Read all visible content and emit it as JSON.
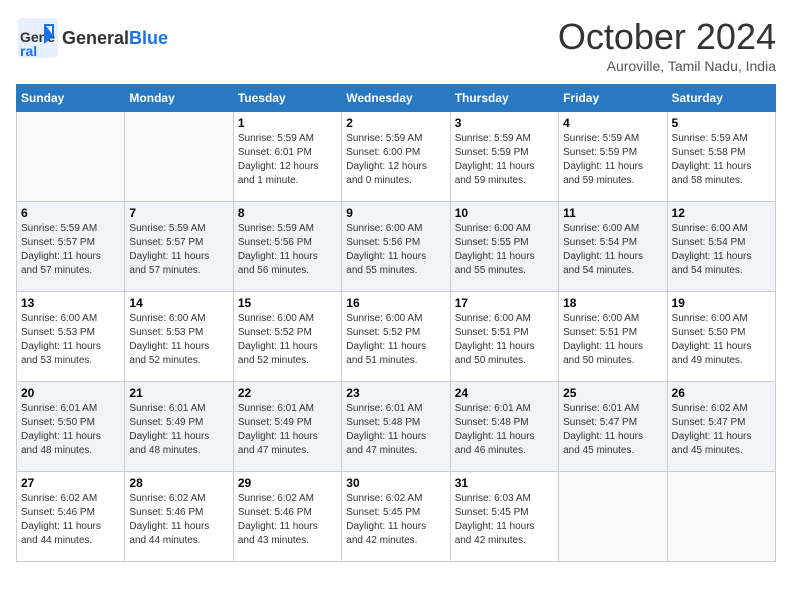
{
  "header": {
    "logo_general": "General",
    "logo_blue": "Blue",
    "month": "October 2024",
    "location": "Auroville, Tamil Nadu, India"
  },
  "weekdays": [
    "Sunday",
    "Monday",
    "Tuesday",
    "Wednesday",
    "Thursday",
    "Friday",
    "Saturday"
  ],
  "weeks": [
    [
      {
        "day": "",
        "info": ""
      },
      {
        "day": "",
        "info": ""
      },
      {
        "day": "1",
        "info": "Sunrise: 5:59 AM\nSunset: 6:01 PM\nDaylight: 12 hours\nand 1 minute."
      },
      {
        "day": "2",
        "info": "Sunrise: 5:59 AM\nSunset: 6:00 PM\nDaylight: 12 hours\nand 0 minutes."
      },
      {
        "day": "3",
        "info": "Sunrise: 5:59 AM\nSunset: 5:59 PM\nDaylight: 11 hours\nand 59 minutes."
      },
      {
        "day": "4",
        "info": "Sunrise: 5:59 AM\nSunset: 5:59 PM\nDaylight: 11 hours\nand 59 minutes."
      },
      {
        "day": "5",
        "info": "Sunrise: 5:59 AM\nSunset: 5:58 PM\nDaylight: 11 hours\nand 58 minutes."
      }
    ],
    [
      {
        "day": "6",
        "info": "Sunrise: 5:59 AM\nSunset: 5:57 PM\nDaylight: 11 hours\nand 57 minutes."
      },
      {
        "day": "7",
        "info": "Sunrise: 5:59 AM\nSunset: 5:57 PM\nDaylight: 11 hours\nand 57 minutes."
      },
      {
        "day": "8",
        "info": "Sunrise: 5:59 AM\nSunset: 5:56 PM\nDaylight: 11 hours\nand 56 minutes."
      },
      {
        "day": "9",
        "info": "Sunrise: 6:00 AM\nSunset: 5:56 PM\nDaylight: 11 hours\nand 55 minutes."
      },
      {
        "day": "10",
        "info": "Sunrise: 6:00 AM\nSunset: 5:55 PM\nDaylight: 11 hours\nand 55 minutes."
      },
      {
        "day": "11",
        "info": "Sunrise: 6:00 AM\nSunset: 5:54 PM\nDaylight: 11 hours\nand 54 minutes."
      },
      {
        "day": "12",
        "info": "Sunrise: 6:00 AM\nSunset: 5:54 PM\nDaylight: 11 hours\nand 54 minutes."
      }
    ],
    [
      {
        "day": "13",
        "info": "Sunrise: 6:00 AM\nSunset: 5:53 PM\nDaylight: 11 hours\nand 53 minutes."
      },
      {
        "day": "14",
        "info": "Sunrise: 6:00 AM\nSunset: 5:53 PM\nDaylight: 11 hours\nand 52 minutes."
      },
      {
        "day": "15",
        "info": "Sunrise: 6:00 AM\nSunset: 5:52 PM\nDaylight: 11 hours\nand 52 minutes."
      },
      {
        "day": "16",
        "info": "Sunrise: 6:00 AM\nSunset: 5:52 PM\nDaylight: 11 hours\nand 51 minutes."
      },
      {
        "day": "17",
        "info": "Sunrise: 6:00 AM\nSunset: 5:51 PM\nDaylight: 11 hours\nand 50 minutes."
      },
      {
        "day": "18",
        "info": "Sunrise: 6:00 AM\nSunset: 5:51 PM\nDaylight: 11 hours\nand 50 minutes."
      },
      {
        "day": "19",
        "info": "Sunrise: 6:00 AM\nSunset: 5:50 PM\nDaylight: 11 hours\nand 49 minutes."
      }
    ],
    [
      {
        "day": "20",
        "info": "Sunrise: 6:01 AM\nSunset: 5:50 PM\nDaylight: 11 hours\nand 48 minutes."
      },
      {
        "day": "21",
        "info": "Sunrise: 6:01 AM\nSunset: 5:49 PM\nDaylight: 11 hours\nand 48 minutes."
      },
      {
        "day": "22",
        "info": "Sunrise: 6:01 AM\nSunset: 5:49 PM\nDaylight: 11 hours\nand 47 minutes."
      },
      {
        "day": "23",
        "info": "Sunrise: 6:01 AM\nSunset: 5:48 PM\nDaylight: 11 hours\nand 47 minutes."
      },
      {
        "day": "24",
        "info": "Sunrise: 6:01 AM\nSunset: 5:48 PM\nDaylight: 11 hours\nand 46 minutes."
      },
      {
        "day": "25",
        "info": "Sunrise: 6:01 AM\nSunset: 5:47 PM\nDaylight: 11 hours\nand 45 minutes."
      },
      {
        "day": "26",
        "info": "Sunrise: 6:02 AM\nSunset: 5:47 PM\nDaylight: 11 hours\nand 45 minutes."
      }
    ],
    [
      {
        "day": "27",
        "info": "Sunrise: 6:02 AM\nSunset: 5:46 PM\nDaylight: 11 hours\nand 44 minutes."
      },
      {
        "day": "28",
        "info": "Sunrise: 6:02 AM\nSunset: 5:46 PM\nDaylight: 11 hours\nand 44 minutes."
      },
      {
        "day": "29",
        "info": "Sunrise: 6:02 AM\nSunset: 5:46 PM\nDaylight: 11 hours\nand 43 minutes."
      },
      {
        "day": "30",
        "info": "Sunrise: 6:02 AM\nSunset: 5:45 PM\nDaylight: 11 hours\nand 42 minutes."
      },
      {
        "day": "31",
        "info": "Sunrise: 6:03 AM\nSunset: 5:45 PM\nDaylight: 11 hours\nand 42 minutes."
      },
      {
        "day": "",
        "info": ""
      },
      {
        "day": "",
        "info": ""
      }
    ]
  ]
}
